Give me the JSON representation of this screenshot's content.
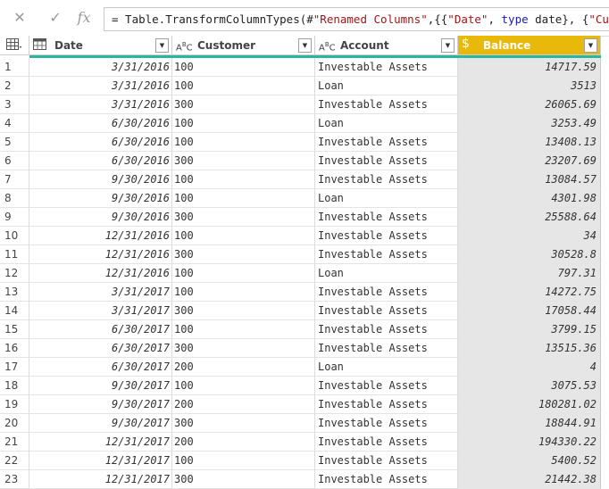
{
  "formula_bar": {
    "prefix": "= Table.TransformColumnTypes(#",
    "str1": "\"Renamed Columns\"",
    "mid1": ",{{",
    "str2": "\"Date\"",
    "mid2": ", ",
    "kw1": "type",
    "mid3": " date}, {",
    "str3": "\"Customer\"",
    "tail": ","
  },
  "columns": [
    {
      "label": "Date",
      "type_icon": "calendar-icon"
    },
    {
      "label": "Customer",
      "type_icon": "abc-text-icon"
    },
    {
      "label": "Account",
      "type_icon": "abc-text-icon"
    },
    {
      "label": "Balance",
      "type_icon": "currency-icon",
      "type_glyph": "$"
    }
  ],
  "rows": [
    {
      "n": "1",
      "date": "3/31/2016",
      "customer": "100",
      "account": "Investable Assets",
      "balance": "14717.59"
    },
    {
      "n": "2",
      "date": "3/31/2016",
      "customer": "100",
      "account": "Loan",
      "balance": "3513"
    },
    {
      "n": "3",
      "date": "3/31/2016",
      "customer": "300",
      "account": "Investable Assets",
      "balance": "26065.69"
    },
    {
      "n": "4",
      "date": "6/30/2016",
      "customer": "100",
      "account": "Loan",
      "balance": "3253.49"
    },
    {
      "n": "5",
      "date": "6/30/2016",
      "customer": "100",
      "account": "Investable Assets",
      "balance": "13408.13"
    },
    {
      "n": "6",
      "date": "6/30/2016",
      "customer": "300",
      "account": "Investable Assets",
      "balance": "23207.69"
    },
    {
      "n": "7",
      "date": "9/30/2016",
      "customer": "100",
      "account": "Investable Assets",
      "balance": "13084.57"
    },
    {
      "n": "8",
      "date": "9/30/2016",
      "customer": "100",
      "account": "Loan",
      "balance": "4301.98"
    },
    {
      "n": "9",
      "date": "9/30/2016",
      "customer": "300",
      "account": "Investable Assets",
      "balance": "25588.64"
    },
    {
      "n": "10",
      "date": "12/31/2016",
      "customer": "100",
      "account": "Investable Assets",
      "balance": "34"
    },
    {
      "n": "11",
      "date": "12/31/2016",
      "customer": "300",
      "account": "Investable Assets",
      "balance": "30528.8"
    },
    {
      "n": "12",
      "date": "12/31/2016",
      "customer": "100",
      "account": "Loan",
      "balance": "797.31"
    },
    {
      "n": "13",
      "date": "3/31/2017",
      "customer": "100",
      "account": "Investable Assets",
      "balance": "14272.75"
    },
    {
      "n": "14",
      "date": "3/31/2017",
      "customer": "300",
      "account": "Investable Assets",
      "balance": "17058.44"
    },
    {
      "n": "15",
      "date": "6/30/2017",
      "customer": "100",
      "account": "Investable Assets",
      "balance": "3799.15"
    },
    {
      "n": "16",
      "date": "6/30/2017",
      "customer": "300",
      "account": "Investable Assets",
      "balance": "13515.36"
    },
    {
      "n": "17",
      "date": "6/30/2017",
      "customer": "200",
      "account": "Loan",
      "balance": "4"
    },
    {
      "n": "18",
      "date": "9/30/2017",
      "customer": "100",
      "account": "Investable Assets",
      "balance": "3075.53"
    },
    {
      "n": "19",
      "date": "9/30/2017",
      "customer": "200",
      "account": "Investable Assets",
      "balance": "180281.02"
    },
    {
      "n": "20",
      "date": "9/30/2017",
      "customer": "300",
      "account": "Investable Assets",
      "balance": "18844.91"
    },
    {
      "n": "21",
      "date": "12/31/2017",
      "customer": "200",
      "account": "Investable Assets",
      "balance": "194330.22"
    },
    {
      "n": "22",
      "date": "12/31/2017",
      "customer": "100",
      "account": "Investable Assets",
      "balance": "5400.52"
    },
    {
      "n": "23",
      "date": "12/31/2017",
      "customer": "300",
      "account": "Investable Assets",
      "balance": "21442.38"
    }
  ]
}
